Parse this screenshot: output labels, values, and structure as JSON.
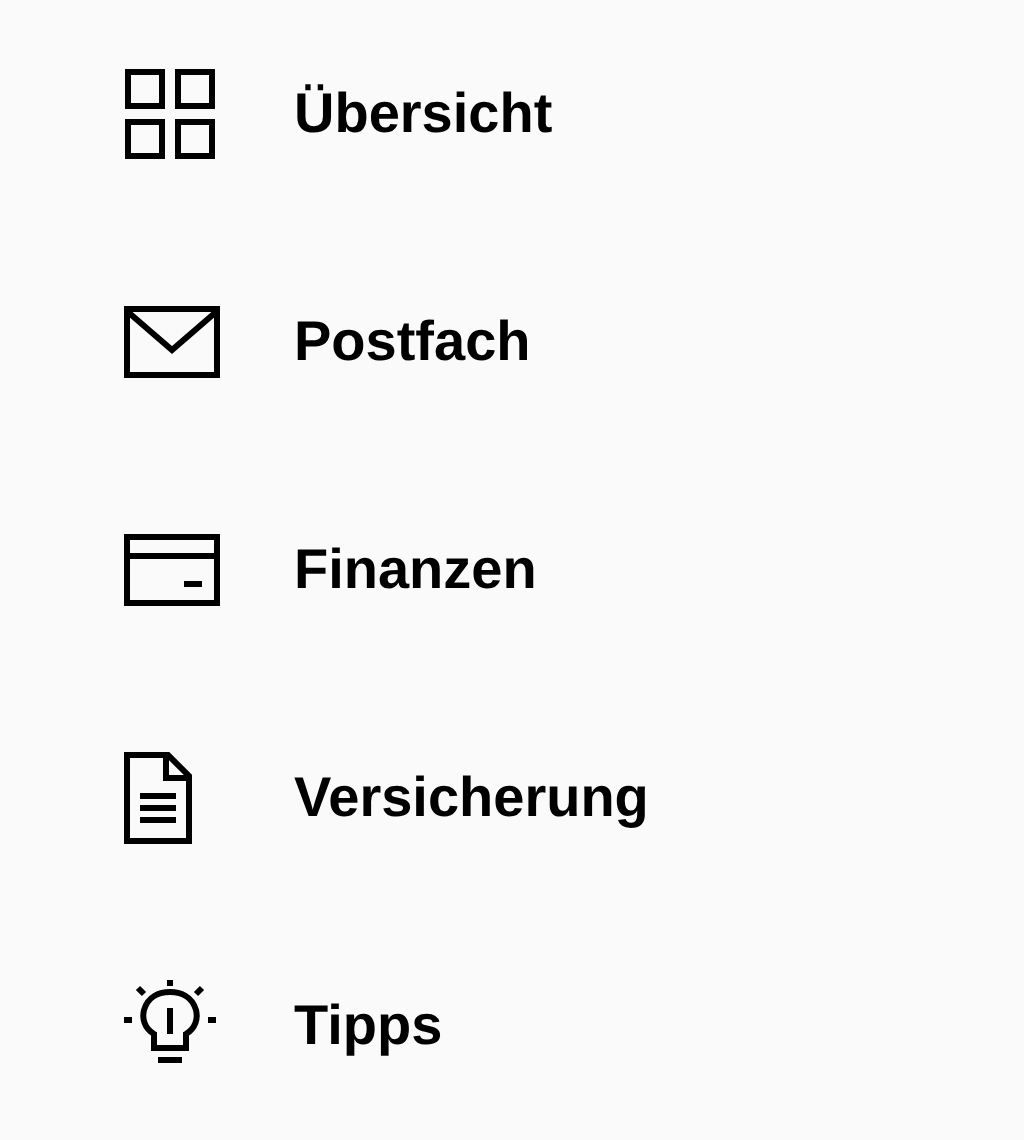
{
  "menu": {
    "items": [
      {
        "label": "Übersicht"
      },
      {
        "label": "Postfach"
      },
      {
        "label": "Finanzen"
      },
      {
        "label": "Versicherung"
      },
      {
        "label": "Tipps"
      }
    ]
  }
}
